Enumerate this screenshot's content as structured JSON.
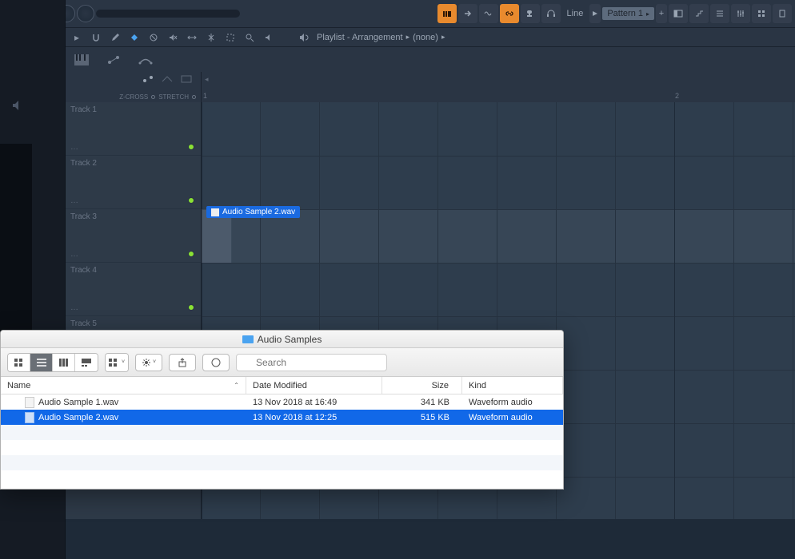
{
  "toolbar": {
    "track_hint": "Track 4",
    "line_label": "Line",
    "pattern_label": "Pattern 1"
  },
  "playlist": {
    "title": "Playlist - Arrangement",
    "arrangement": "(none)",
    "zcross": "Z-CROSS",
    "stretch": "STRETCH"
  },
  "ruler": {
    "n1": "1",
    "n2": "2"
  },
  "tracks": [
    {
      "name": "Track 1"
    },
    {
      "name": "Track 2"
    },
    {
      "name": "Track 3"
    },
    {
      "name": "Track 4"
    },
    {
      "name": "Track 5"
    }
  ],
  "clip": {
    "label": "Audio Sample 2.wav"
  },
  "finder": {
    "title": "Audio Samples",
    "search_placeholder": "Search",
    "cols": {
      "name": "Name",
      "date": "Date Modified",
      "size": "Size",
      "kind": "Kind"
    },
    "rows": [
      {
        "name": "Audio Sample 1.wav",
        "date": "13 Nov 2018 at 16:49",
        "size": "341 KB",
        "kind": "Waveform audio",
        "selected": false
      },
      {
        "name": "Audio Sample 2.wav",
        "date": "13 Nov 2018 at 12:25",
        "size": "515 KB",
        "kind": "Waveform audio",
        "selected": true
      }
    ]
  }
}
